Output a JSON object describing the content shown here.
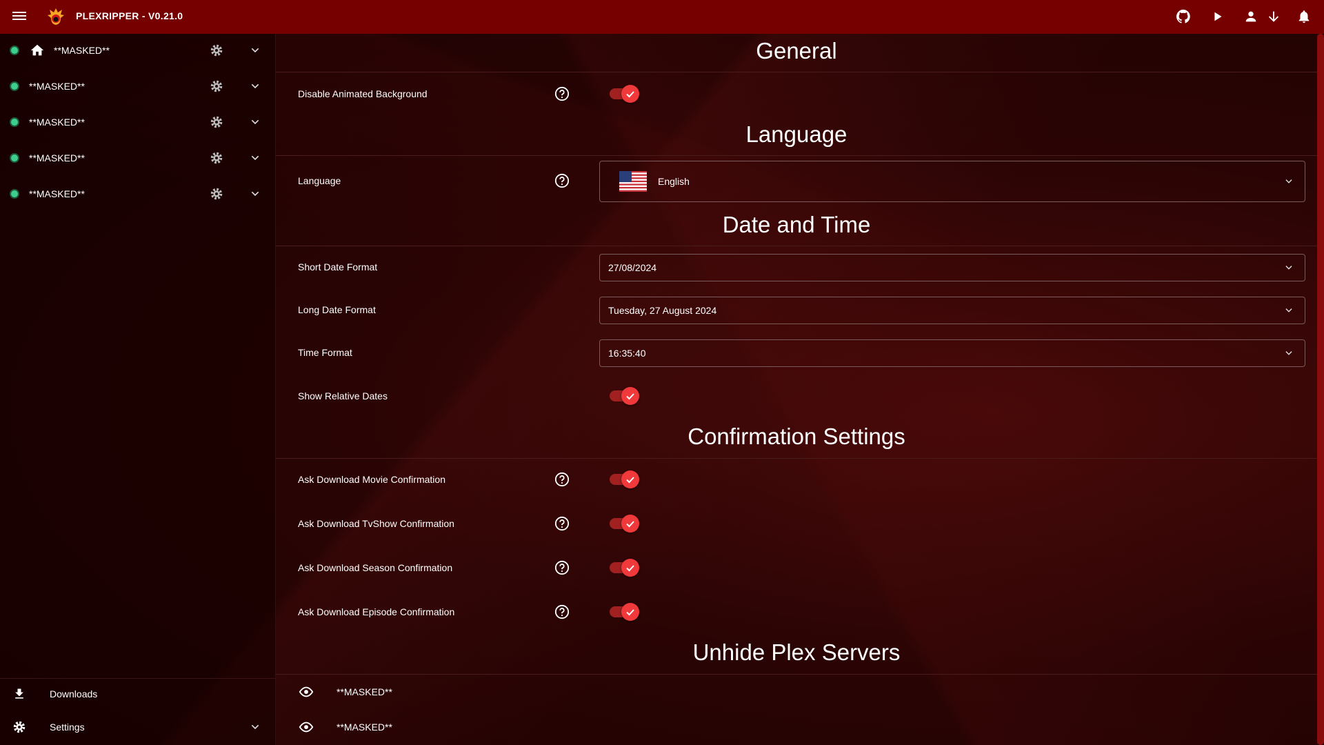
{
  "app": {
    "title": "PLEXRIPPER - V0.21.0"
  },
  "topbar_icons": [
    "github-icon",
    "play-icon",
    "account-icon",
    "download-icon",
    "bell-icon"
  ],
  "sidebar": {
    "servers": [
      {
        "name": "**MASKED**",
        "home": true,
        "status": "online"
      },
      {
        "name": "**MASKED**",
        "status": "online"
      },
      {
        "name": "**MASKED**",
        "status": "online"
      },
      {
        "name": "**MASKED**",
        "status": "online"
      },
      {
        "name": "**MASKED**",
        "status": "online"
      }
    ],
    "downloads": "Downloads",
    "settings": "Settings"
  },
  "sections": {
    "general": {
      "title": "General",
      "disable_bg": {
        "label": "Disable Animated Background",
        "value": true
      }
    },
    "language": {
      "title": "Language",
      "label": "Language",
      "value": "English"
    },
    "datetime": {
      "title": "Date and Time",
      "short": {
        "label": "Short Date Format",
        "value": "27/08/2024"
      },
      "long": {
        "label": "Long Date Format",
        "value": "Tuesday, 27 August 2024"
      },
      "time": {
        "label": "Time Format",
        "value": "16:35:40"
      },
      "relative": {
        "label": "Show Relative Dates",
        "value": true
      }
    },
    "confirm": {
      "title": "Confirmation Settings",
      "items": [
        {
          "label": "Ask Download Movie Confirmation",
          "value": true
        },
        {
          "label": "Ask Download TvShow Confirmation",
          "value": true
        },
        {
          "label": "Ask Download Season Confirmation",
          "value": true
        },
        {
          "label": "Ask Download Episode Confirmation",
          "value": true
        }
      ]
    },
    "unhide": {
      "title": "Unhide Plex Servers",
      "servers": [
        "**MASKED**",
        "**MASKED**"
      ]
    }
  },
  "colors": {
    "topbar": "#760000",
    "accent": "#f0393b",
    "online": "#3ecf8e"
  }
}
